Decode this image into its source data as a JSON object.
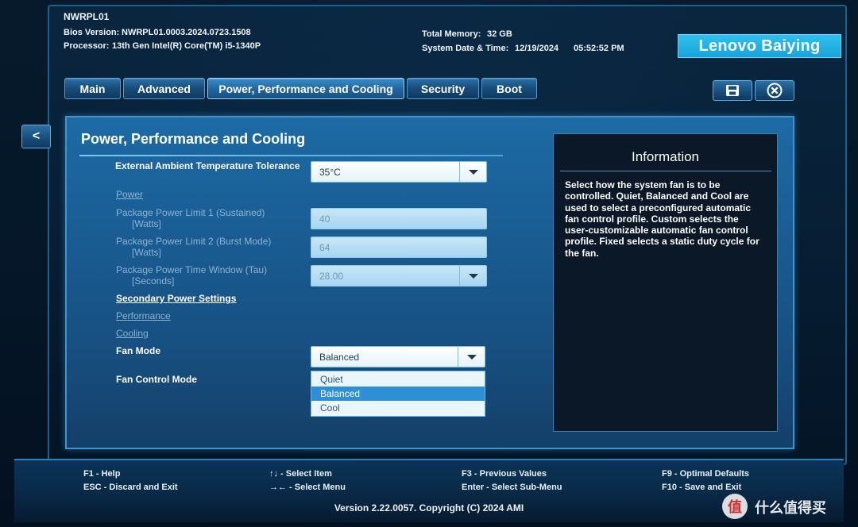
{
  "header": {
    "model": "NWRPL01",
    "bios_label": "Bios Version:",
    "bios_value": "NWRPL01.0003.2024.0723.1508",
    "processor_label": "Processor:",
    "processor_value": "13th Gen Intel(R) Core(TM) i5-1340P",
    "memory_label": "Total Memory:",
    "memory_value": "32 GB",
    "datetime_label": "System Date & Time:",
    "date_value": "12/19/2024",
    "time_value": "05:52:52 PM",
    "logo": "Lenovo Baiying"
  },
  "tabs": [
    {
      "label": "Main"
    },
    {
      "label": "Advanced"
    },
    {
      "label": "Power, Performance and Cooling"
    },
    {
      "label": "Security"
    },
    {
      "label": "Boot"
    }
  ],
  "toolbar": {
    "back": "<",
    "save_icon": "floppy-disk",
    "exit_icon": "close-circle"
  },
  "main": {
    "title": "Power, Performance and Cooling",
    "ambient": {
      "label": "External Ambient Temperature Tolerance",
      "value": "35°C"
    },
    "power_section": "Power",
    "ppl1": {
      "label": "Package Power Limit 1 (Sustained)",
      "unit": "[Watts]",
      "value": "40"
    },
    "ppl2": {
      "label": "Package Power Limit 2 (Burst Mode)",
      "unit": "[Watts]",
      "value": "64"
    },
    "tau": {
      "label": "Package Power Time Window (Tau)",
      "unit": "[Seconds]",
      "value": "28.00"
    },
    "secondary": "Secondary Power Settings",
    "performance": "Performance",
    "cooling": "Cooling",
    "fan_mode": {
      "label": "Fan Mode",
      "value": "Balanced"
    },
    "fan_control": {
      "label": "Fan Control Mode"
    },
    "fan_options": [
      "Quiet",
      "Balanced",
      "Cool"
    ]
  },
  "info": {
    "title": "Information",
    "text": "Select how the system fan is to be controlled. Quiet, Balanced and Cool are used to select a preconfigured automatic fan control profile. Custom selects the user-customizable automatic fan control profile. Fixed selects a static duty cycle for the fan."
  },
  "footer": {
    "f1": "F1 - Help",
    "esc": "ESC - Discard and Exit",
    "select_item": "↑↓ - Select Item",
    "select_menu": "→← - Select Menu",
    "f3": "F3 - Previous Values",
    "enter": "Enter - Select Sub-Menu",
    "f9": "F9 - Optimal Defaults",
    "f10": "F10 - Save and Exit",
    "version": "Version 2.22.0057. Copyright (C) 2024 AMI"
  },
  "watermark": {
    "badge": "值",
    "text": "什么值得买"
  }
}
